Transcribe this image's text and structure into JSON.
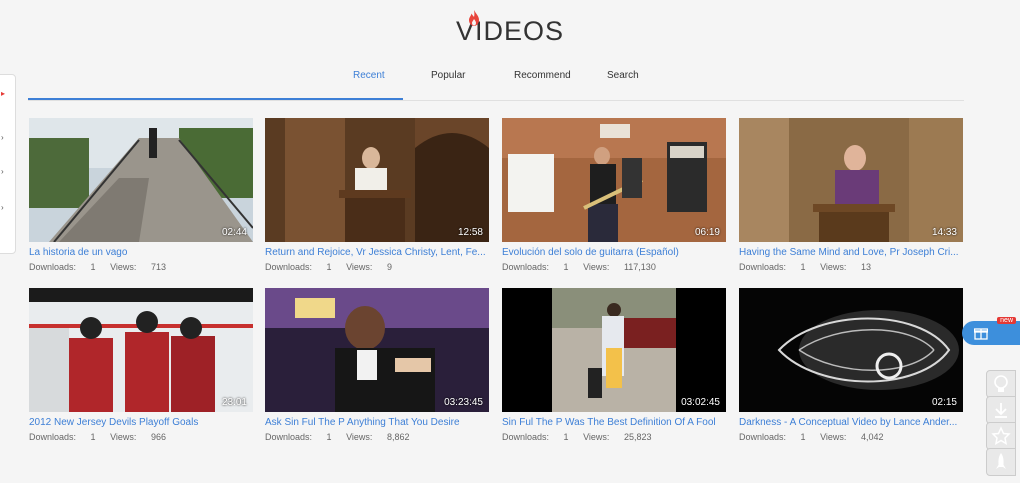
{
  "header": {
    "title": "VIDEOS"
  },
  "tabs": [
    {
      "label": "Recent"
    },
    {
      "label": "Popular"
    },
    {
      "label": "Recommend"
    },
    {
      "label": "Search"
    }
  ],
  "accent_color": "#3d7fd6",
  "labels": {
    "downloads": "Downloads:",
    "views": "Views:"
  },
  "gift_badge": "new",
  "videos": [
    {
      "title": "La historia de un vago",
      "duration": "02:44",
      "downloads": "1",
      "views": "713"
    },
    {
      "title": "Return and Rejoice, Vr Jessica Christy, Lent, Fe...",
      "duration": "12:58",
      "downloads": "1",
      "views": "9"
    },
    {
      "title": "Evolución del solo de guitarra (Español)",
      "duration": "06:19",
      "downloads": "1",
      "views": "117,130"
    },
    {
      "title": "Having the Same Mind and Love, Pr Joseph Cri...",
      "duration": "14:33",
      "downloads": "1",
      "views": "13"
    },
    {
      "title": "2012 New Jersey Devils Playoff Goals",
      "duration": "23:01",
      "downloads": "1",
      "views": "966"
    },
    {
      "title": "Ask Sin Ful The P Anything That You Desire",
      "duration": "03:23:45",
      "downloads": "1",
      "views": "8,862"
    },
    {
      "title": "Sin Ful The P Was The Best Definition Of A Fool",
      "duration": "03:02:45",
      "downloads": "1",
      "views": "25,823"
    },
    {
      "title": "Darkness - A Conceptual Video by Lance Ander...",
      "duration": "02:15",
      "downloads": "1",
      "views": "4,042"
    }
  ],
  "side_buttons": [
    "lightbulb-icon",
    "download-icon",
    "star-icon",
    "rocket-icon"
  ]
}
